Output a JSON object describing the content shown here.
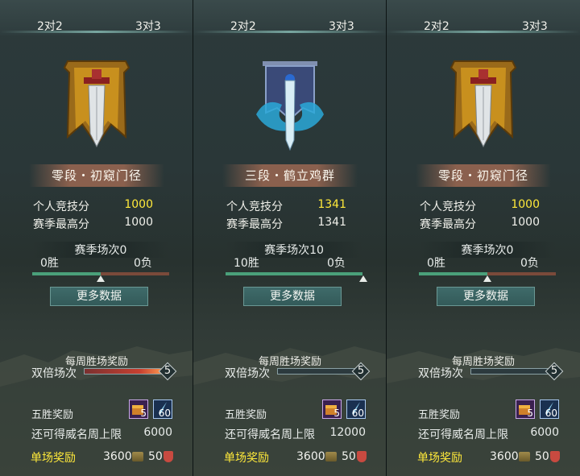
{
  "panels": [
    {
      "modes": [
        "2对2",
        "3对3"
      ],
      "rank_title": "零段・初窥门径",
      "emblem": "gold-banner-sword",
      "personal_score_label": "个人竞技分",
      "personal_score": "1000",
      "season_high_label": "赛季最高分",
      "season_high": "1000",
      "season_matches": "赛季场次0",
      "wins": "0胜",
      "losses": "0负",
      "win_ratio": 0.5,
      "more_button": "更多数据",
      "weekly_reward": "每周胜场奖励",
      "double_label": "双倍场次",
      "double_count": "5",
      "double_fill": 1.0,
      "five_win_label": "五胜奖励",
      "item1_count": "5",
      "item2_count": "60",
      "cap_label": "还可得威名周上限",
      "cap_value": "6000",
      "single_label": "单场奖励",
      "coin_value": "3600",
      "shield_value": "50"
    },
    {
      "modes": [
        "2对2",
        "3对3"
      ],
      "rank_title": "三段・鹤立鸡群",
      "emblem": "blue-dragon-sword",
      "personal_score_label": "个人竞技分",
      "personal_score": "1341",
      "season_high_label": "赛季最高分",
      "season_high": "1341",
      "season_matches": "赛季场次10",
      "wins": "10胜",
      "losses": "0负",
      "win_ratio": 1.0,
      "more_button": "更多数据",
      "weekly_reward": "每周胜场奖励",
      "double_label": "双倍场次",
      "double_count": "5",
      "double_fill": 0.0,
      "five_win_label": "五胜奖励",
      "item1_count": "5",
      "item2_count": "60",
      "cap_label": "还可得威名周上限",
      "cap_value": "12000",
      "single_label": "单场奖励",
      "coin_value": "3600",
      "shield_value": "50"
    },
    {
      "modes": [
        "2对2",
        "3对3"
      ],
      "rank_title": "零段・初窥门径",
      "emblem": "gold-banner-sword",
      "personal_score_label": "个人竞技分",
      "personal_score": "1000",
      "season_high_label": "赛季最高分",
      "season_high": "1000",
      "season_matches": "赛季场次0",
      "wins": "0胜",
      "losses": "0负",
      "win_ratio": 0.5,
      "more_button": "更多数据",
      "weekly_reward": "每周胜场奖励",
      "double_label": "双倍场次",
      "double_count": "5",
      "double_fill": 0.0,
      "five_win_label": "五胜奖励",
      "item1_count": "5",
      "item2_count": "60",
      "cap_label": "还可得威名周上限",
      "cap_value": "6000",
      "single_label": "单场奖励",
      "coin_value": "3600",
      "shield_value": "50"
    }
  ],
  "colors": {
    "highlight_yellow": "#ffe93a",
    "progress_green": "#4aa07a",
    "progress_red": "#7a4a3a",
    "button_teal": "#3f6b6a"
  }
}
